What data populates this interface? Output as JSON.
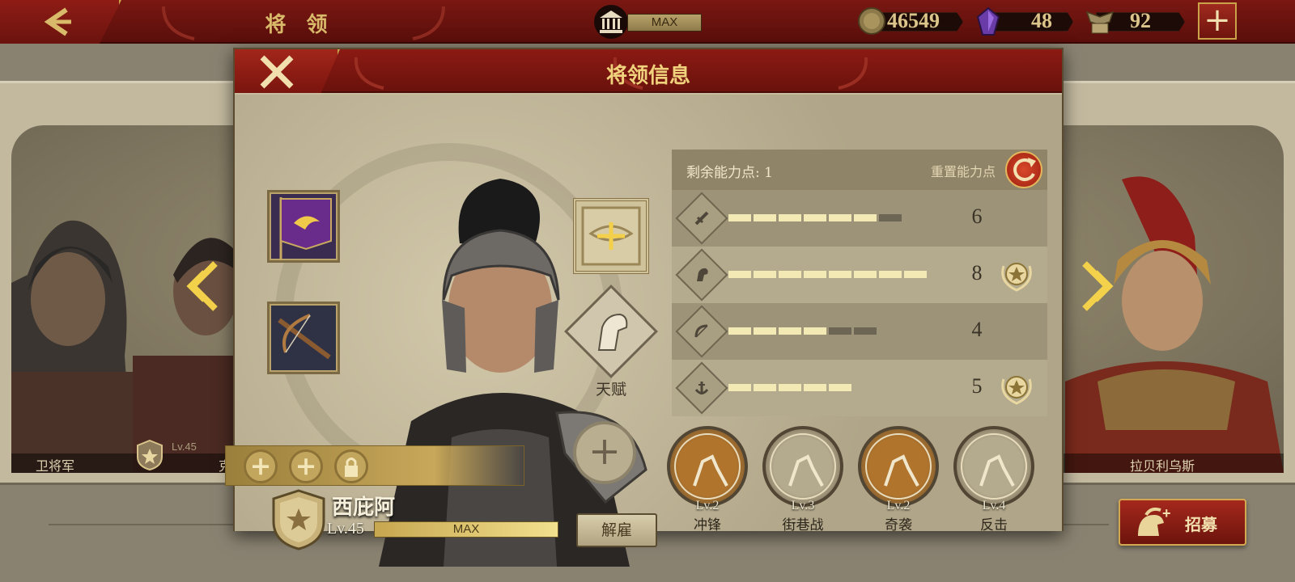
{
  "top_bar": {
    "title": "将 领",
    "building_level": "MAX",
    "coins": "46549",
    "gems": "48",
    "spqr": "92"
  },
  "dialog": {
    "title": "将领信息",
    "talent_label": "天赋",
    "hero": {
      "name": "西庇阿",
      "level": "Lv.45",
      "exp_text": "MAX",
      "dismiss_label": "解雇"
    },
    "stats": {
      "points_label": "剩余能力点: 1",
      "reset_label": "重置能力点",
      "rows": [
        {
          "icon": "sword-icon",
          "value": "6",
          "filled": 6,
          "total": 7,
          "starred": false
        },
        {
          "icon": "horse-icon",
          "value": "8",
          "filled": 8,
          "total": 8,
          "starred": true
        },
        {
          "icon": "bow-icon",
          "value": "4",
          "filled": 4,
          "total": 6,
          "starred": false
        },
        {
          "icon": "anchor-icon",
          "value": "5",
          "filled": 5,
          "total": 5,
          "starred": true
        }
      ]
    },
    "skills": [
      {
        "level": "Lv.2",
        "name": "冲锋",
        "tone": "#b0742c"
      },
      {
        "level": "Lv.3",
        "name": "街巷战",
        "tone": "#b4aa8e"
      },
      {
        "level": "Lv.2",
        "name": "奇袭",
        "tone": "#b0742c"
      },
      {
        "level": "Lv.4",
        "name": "反击",
        "tone": "#b4aa8e"
      }
    ]
  },
  "side_heroes": {
    "left_name": "卫将军",
    "left2_level": "Lv.45",
    "left2_name": "克",
    "right_name": "拉贝利乌斯"
  },
  "recruit_label": "招募",
  "colors": {
    "header_red": "#7a1712",
    "gold": "#c9a24a",
    "bar_fill": "#f3e9b4",
    "bar_empty": "#6e6655"
  }
}
